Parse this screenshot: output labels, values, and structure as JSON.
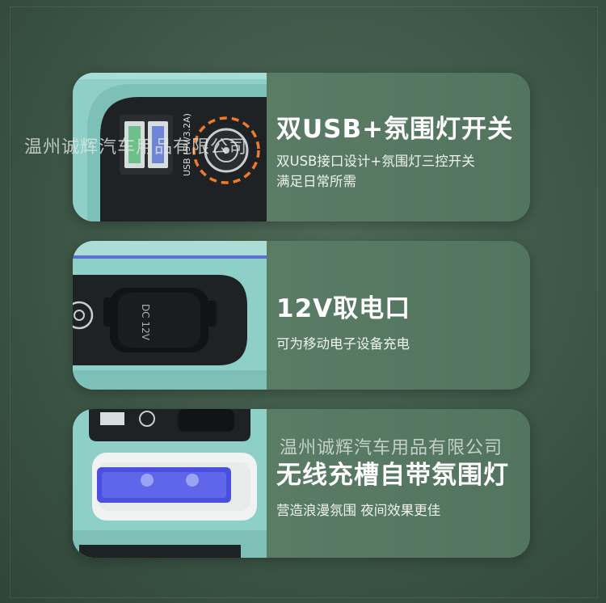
{
  "features": [
    {
      "title": "双USB+氛围灯开关",
      "lines": [
        "双USB接口设计+氛围灯三控开关",
        "满足日常所需"
      ],
      "photo_label": "USB (5V/3.2A)"
    },
    {
      "title": "12V取电口",
      "lines": [
        "可为移动电子设备充电"
      ],
      "photo_label": "DC 12V"
    },
    {
      "title": "无线充槽自带氛围灯",
      "lines": [
        "营造浪漫氛围 夜间效果更佳"
      ]
    }
  ],
  "watermarks": [
    "温州诚辉汽车用品有限公司",
    "温州诚辉汽车用品有限公司"
  ],
  "colors": {
    "background": "#3d5646",
    "card": "#5a7b64",
    "device_body": "#8ecfc7",
    "panel": "#1e2224",
    "highlight_ring": "#f07a2a",
    "ambient_light": "#4b4fe0"
  }
}
